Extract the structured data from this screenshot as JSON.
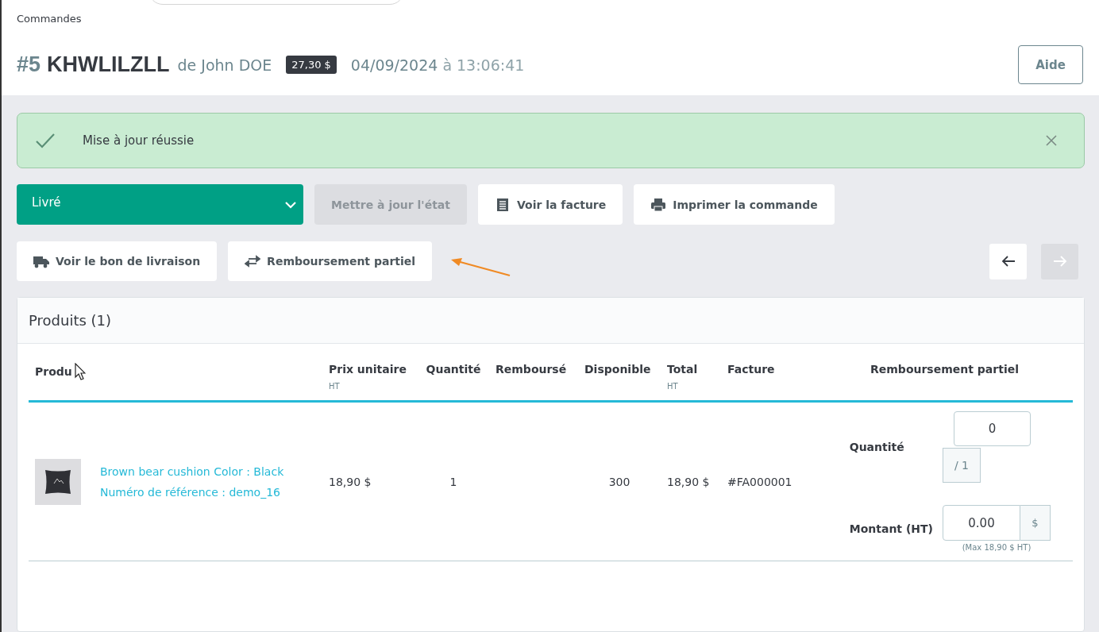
{
  "breadcrumb": "Commandes",
  "order": {
    "number": "#5",
    "reference": "KHWLILZLL",
    "customer": "de John DOE",
    "total": "27,30 $",
    "date": "04/09/2024",
    "time_prefix": "à",
    "time": "13:06:41"
  },
  "help_button": "Aide",
  "alert": {
    "message": "Mise à jour réussie"
  },
  "status_select": {
    "value": "Livré"
  },
  "actions": [
    {
      "label": "Mettre à jour l'état",
      "disabled": true
    },
    {
      "label": "Voir la facture",
      "disabled": false
    },
    {
      "label": "Imprimer la commande",
      "disabled": false
    }
  ],
  "actions_row2": [
    {
      "label": "Voir le bon de livraison",
      "disabled": false
    },
    {
      "label": "Remboursement partiel",
      "disabled": false
    }
  ],
  "pager": [
    {
      "disabled": false
    },
    {
      "disabled": true
    }
  ],
  "products": {
    "title": "Produits (1)",
    "columns": [
      {
        "label": "Produ"
      },
      {
        "label": "Prix unitaire",
        "sub": "HT"
      },
      {
        "label": "Quantité"
      },
      {
        "label": "Remboursé"
      },
      {
        "label": "Disponible"
      },
      {
        "label": "Total",
        "sub": "HT"
      },
      {
        "label": "Facture"
      },
      {
        "label": "Remboursement partiel"
      }
    ],
    "rows": [
      {
        "name": "Brown bear cushion Color : Black",
        "reference": "Numéro de référence : demo_16",
        "unit_price": "18,90 $",
        "quantity": "1",
        "available": "300",
        "total": "18,90 $",
        "invoice": "#FA000001",
        "refund": {
          "quantity_label": "Quantité",
          "quantity_value": "0",
          "quantity_max": "/ 1",
          "amount_label": "Montant (HT)",
          "amount_value": "0.00",
          "currency": "$",
          "amount_hint": "(Max 18,90 $ HT)"
        }
      }
    ]
  }
}
